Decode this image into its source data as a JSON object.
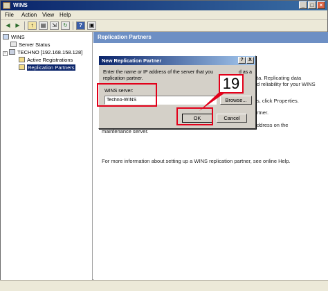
{
  "window": {
    "title": "WINS"
  },
  "menu": [
    "File",
    "Action",
    "View",
    "Help"
  ],
  "toolbar": {
    "icons": [
      "back-arrow-icon",
      "forward-arrow-icon",
      "up-folder-icon",
      "show-tree-icon",
      "export-icon",
      "refresh-icon",
      "help-icon",
      "properties-icon"
    ]
  },
  "tree": {
    "root": "WINS",
    "server_status": "Server Status",
    "server": "TECHNO [192.168.158.128]",
    "active_registrations": "Active Registrations",
    "replication_partners": "Replication Partners"
  },
  "pane": {
    "header": "Replication Partners",
    "fragments": {
      "line1_end": "ta. Replicating data",
      "line2_end": "d reliability for your WINS",
      "line3_end": "s, click Properties.",
      "line4_end": "rtner.",
      "line5_end": "ddress on the",
      "line6": "maintenance server."
    },
    "more_info": "For more information about setting up a WINS replication partner, see online Help."
  },
  "dialog": {
    "title": "New Replication Partner",
    "help_btn": "?",
    "close_btn": "X",
    "instruction_1": "Enter the name or IP address of the server that you",
    "instruction_1_end": "d as a",
    "instruction_2": "replication partner.",
    "field_label": "WINS server:",
    "field_value": "Techno-WINS",
    "browse": "Browse...",
    "ok": "OK",
    "cancel": "Cancel"
  },
  "annotation": {
    "step": "19",
    "color": "#e2001a"
  }
}
